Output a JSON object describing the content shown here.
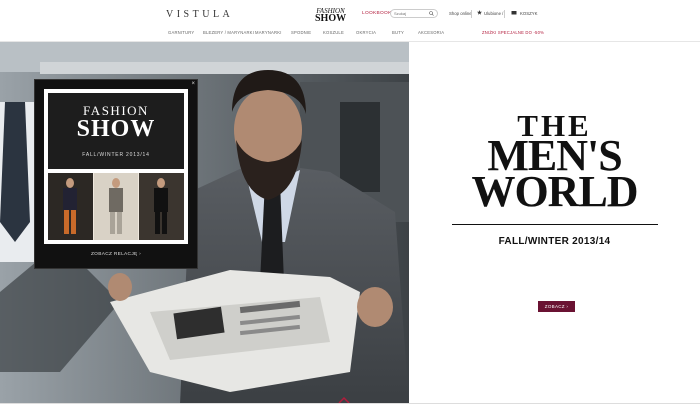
{
  "header": {
    "logo": "VISTULA",
    "fashion_logo_top": "FASHION",
    "fashion_logo_bottom": "SHOW",
    "lookbook": "LOOKBOOK",
    "search_placeholder": "Szukaj",
    "shop_online": "Shop online",
    "wishlist": "Ulubione /",
    "cart": "KOSZYK"
  },
  "nav": {
    "items": [
      "GARNITURY",
      "BLEZERY / MARYNARKI",
      "MARYNARKI",
      "SPODNIE",
      "KOSZULE",
      "OKRYCIA",
      "BUTY",
      "AKCESORIA"
    ],
    "sale": "ZNIŻKI SPECJALNE DO -50%"
  },
  "popup": {
    "close": "×",
    "title_top": "FASHION",
    "title_bottom": "SHOW",
    "season": "FALL/WINTER 2013/14",
    "cta": "ZOBACZ RELACJĘ ›"
  },
  "campaign": {
    "line1": "THE",
    "line2": "MEN'S",
    "line3": "WORLD",
    "season": "FALL/WINTER 2013/14",
    "button": "ZOBACZ ›",
    "button_color": "#6a1232"
  },
  "colors": {
    "accent": "#b21c3c"
  }
}
